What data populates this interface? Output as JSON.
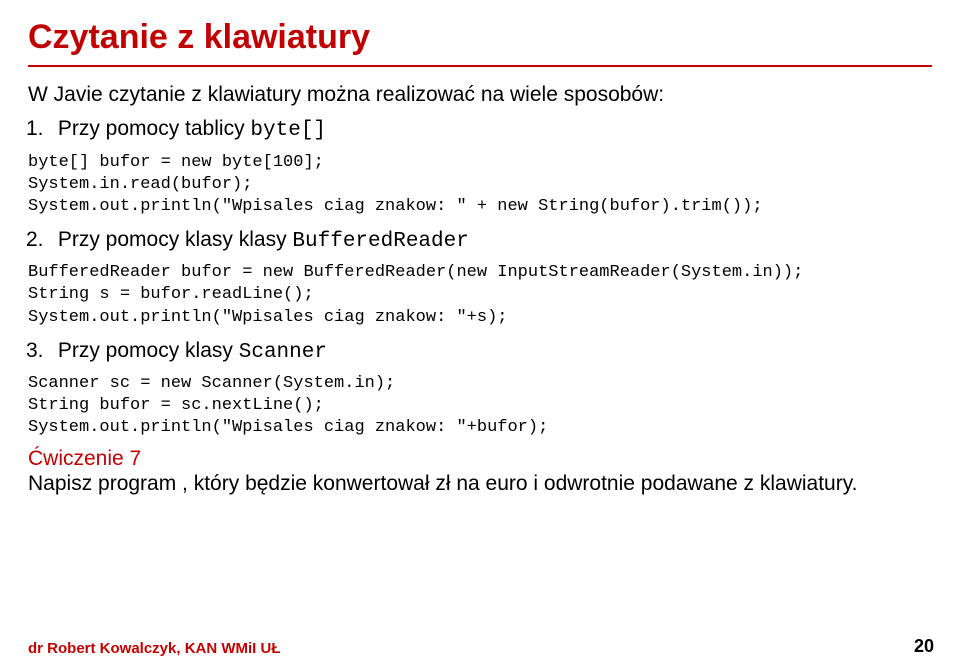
{
  "title": "Czytanie z klawiatury",
  "intro": "W Javie czytanie z klawiatury można realizować na wiele sposobów:",
  "items": [
    {
      "num": "1.",
      "text_before": "Przy pomocy tablicy ",
      "mono": "byte[]"
    },
    {
      "num": "2.",
      "text_before": "Przy pomocy klasy klasy ",
      "mono": "BufferedReader"
    },
    {
      "num": "3.",
      "text_before": "Przy pomocy klasy ",
      "mono": "Scanner"
    }
  ],
  "code1": "byte[] bufor = new byte[100];\nSystem.in.read(bufor);\nSystem.out.println(\"Wpisales ciag znakow: \" + new String(bufor).trim());",
  "code2": "BufferedReader bufor = new BufferedReader(new InputStreamReader(System.in));\nString s = bufor.readLine();\nSystem.out.println(\"Wpisales ciag znakow: \"+s);",
  "code3": "Scanner sc = new Scanner(System.in);\nString bufor = sc.nextLine();\nSystem.out.println(\"Wpisales ciag znakow: \"+bufor);",
  "exercise": {
    "title": "Ćwiczenie 7",
    "body": "Napisz program , który będzie konwertował zł na euro i odwrotnie podawane z klawiatury."
  },
  "footer": "dr Robert Kowalczyk, KAN WMiI UŁ",
  "page": "20"
}
